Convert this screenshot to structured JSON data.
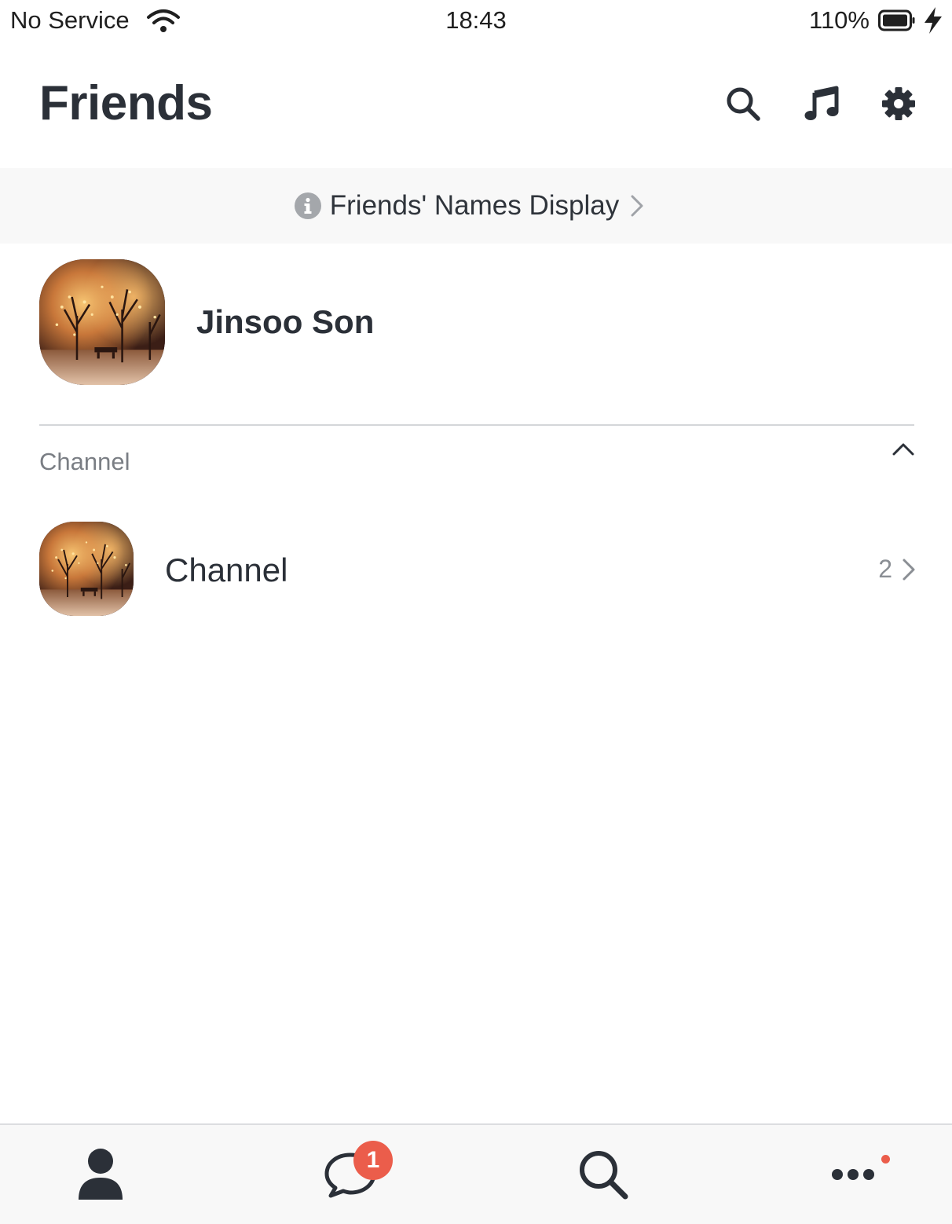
{
  "status_bar": {
    "carrier": "No Service",
    "time": "18:43",
    "battery": "110%"
  },
  "header": {
    "title": "Friends",
    "actions": [
      "search-icon",
      "music-note-icon",
      "gear-icon"
    ]
  },
  "banner": {
    "label": "Friends' Names Display",
    "icon": "info-icon"
  },
  "profile": {
    "name": "Jinsoo Son"
  },
  "channel_section": {
    "title": "Channel",
    "expanded": true,
    "items": [
      {
        "name": "Channel",
        "count": "2"
      }
    ]
  },
  "tab_bar": {
    "tabs": [
      {
        "icon": "person-icon",
        "selected": true
      },
      {
        "icon": "chat-bubble-icon",
        "badge": "1"
      },
      {
        "icon": "search-icon"
      },
      {
        "icon": "more-icon",
        "dot": true
      }
    ]
  },
  "colors": {
    "text": "#2b3038",
    "muted": "#7a7e84",
    "badge": "#eb5d4b",
    "banner_bg": "#f8f8f8"
  }
}
